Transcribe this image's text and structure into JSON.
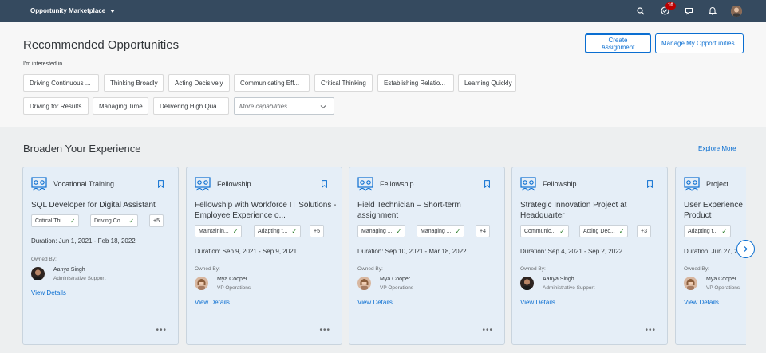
{
  "shell": {
    "title": "Opportunity Marketplace",
    "notification_count": "10"
  },
  "recommended": {
    "heading": "Recommended Opportunities",
    "create_label": "Create Assignment",
    "manage_label": "Manage My Opportunities",
    "interest_label": "I'm interested in...",
    "chips": [
      "Driving Continuous ...",
      "Thinking Broadly",
      "Acting Decisively",
      "Communicating Eff...",
      "Critical Thinking",
      "Establishing Relatio...",
      "Learning Quickly",
      "Driving for Results",
      "Managing Time",
      "Delivering High Qua..."
    ],
    "more_placeholder": "More capabilities"
  },
  "broaden": {
    "heading": "Broaden Your Experience",
    "explore_label": "Explore More"
  },
  "labels": {
    "owned_by": "Owned By:",
    "view_details": "View Details"
  },
  "cards": [
    {
      "type": "Vocational Training",
      "title": "SQL Developer for Digital Assistant",
      "caps": [
        "Critical Thi...",
        "Driving Co..."
      ],
      "more": "+5",
      "duration": "Duration: Jun 1, 2021 - Feb 18, 2022",
      "owner": "Aanya Singh",
      "role": "Administrative Support"
    },
    {
      "type": "Fellowship",
      "title": "Fellowship with Workforce IT Solutions - Employee Experience o...",
      "caps": [
        "Maintainin...",
        "Adapting t..."
      ],
      "more": "+5",
      "duration": "Duration: Sep 9, 2021 - Sep 9, 2021",
      "owner": "Mya Cooper",
      "role": "VP Operations"
    },
    {
      "type": "Fellowship",
      "title": "Field Technician – Short-term assignment",
      "caps": [
        "Managing ...",
        "Managing ..."
      ],
      "more": "+4",
      "duration": "Duration: Sep 10, 2021 - Mar 18, 2022",
      "owner": "Mya Cooper",
      "role": "VP Operations"
    },
    {
      "type": "Fellowship",
      "title": "Strategic Innovation Project at Headquarter",
      "caps": [
        "Communic...",
        "Acting Dec..."
      ],
      "more": "+3",
      "duration": "Duration: Sep 4, 2021 - Sep 2, 2022",
      "owner": "Aanya Singh",
      "role": "Administrative Support"
    },
    {
      "type": "Project",
      "title": "User Experience Product",
      "caps": [
        "Adapting t..."
      ],
      "more": "",
      "duration": "Duration: Jun 27, 2",
      "owner": "Mya Cooper",
      "role": "VP Operations"
    }
  ],
  "colors": {
    "shell_bg": "#354a5f",
    "accent": "#0a6ed1",
    "card_bg": "#e5eef7",
    "badge": "#bb0000",
    "check": "#2b7d2b"
  }
}
